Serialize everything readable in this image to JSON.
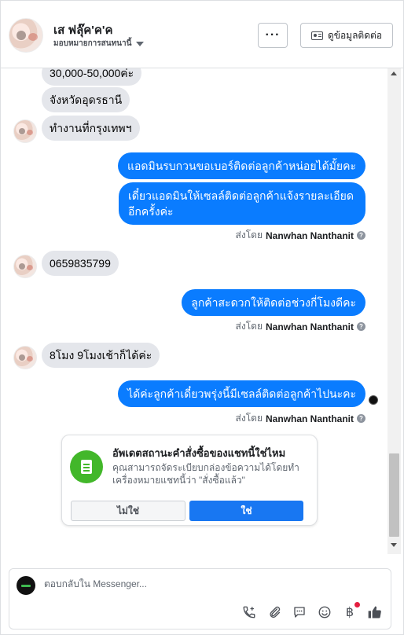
{
  "header": {
    "contact_name": "เส ฟลุ๊ค'ค'ค",
    "assign_label": "มอบหมายการสนทนานี้",
    "more_label": "···",
    "contact_info_label": "ดูข้อมูลติดต่อ"
  },
  "messages": {
    "in_1": "30,000-50,000ค่ะ",
    "in_2": "จังหวัดอุดรธานี",
    "in_3": "ทำงานที่กรุงเทพฯ",
    "out_1": "แอดมินรบกวนขอเบอร์ติดต่อลูกค้าหน่อยได้มั้ยคะ",
    "out_2_line1": "เดี๋ยวแอดมินให้เซลล์ติดต่อลูกค้าแจ้งรายละเอียด",
    "out_2_line2": "อีกครั้งค่ะ",
    "in_4": "0659835799",
    "out_3": "ลูกค้าสะดวกให้ติดต่อช่วงกี่โมงดีคะ",
    "in_5": "8โมง 9โมงเช้าก็ได้ค่ะ",
    "out_4": "ได้ค่ะลูกค้าเดี๋ยวพรุ่งนี้มีเซลล์ติดต่อลูกค้าไปนะคะ"
  },
  "sent_by": {
    "prefix": "ส่งโดย",
    "name": "Nanwhan Nanthanit",
    "help": "?"
  },
  "order_card": {
    "title": "อัพเดตสถานะคำสั่งซื้อของแชทนี้ใช่ไหม",
    "description": "คุณสามารถจัดระเบียบกล่องข้อความได้โดยทำเครื่องหมายแชทนี้ว่า \"สั่งซื้อแล้ว\"",
    "no_label": "ไม่ใช่",
    "yes_label": "ใช่"
  },
  "composer": {
    "placeholder": "ตอบกลับใน Messenger...",
    "baht_symbol": "฿"
  },
  "colors": {
    "outgoing_bubble": "#0a7cff",
    "incoming_bubble": "#e4e6eb",
    "primary_button": "#1877f2",
    "order_icon": "#42b72a",
    "notification_dot": "#e41e3f"
  }
}
